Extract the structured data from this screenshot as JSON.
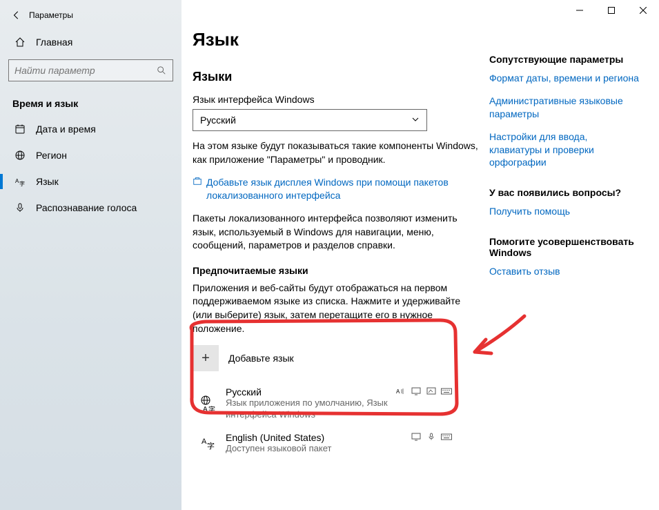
{
  "window": {
    "title": "Параметры"
  },
  "sidebar": {
    "home": "Главная",
    "search_placeholder": "Найти параметр",
    "group": "Время и язык",
    "items": [
      {
        "icon": "clock-icon",
        "label": "Дата и время"
      },
      {
        "icon": "globe-icon",
        "label": "Регион"
      },
      {
        "icon": "lang-icon",
        "label": "Язык",
        "active": true
      },
      {
        "icon": "mic-icon",
        "label": "Распознавание голоса"
      }
    ]
  },
  "main": {
    "h1": "Язык",
    "h2": "Языки",
    "display_label": "Язык интерфейса Windows",
    "display_value": "Русский",
    "display_desc": "На этом языке будут показываться такие компоненты Windows, как приложение \"Параметры\" и проводник.",
    "store_link": "Добавьте язык дисплея Windows при помощи пакетов локализованного интерфейса",
    "store_desc": "Пакеты локализованного интерфейса позволяют изменить язык, используемый в Windows для навигации, меню, сообщений, параметров и разделов справки.",
    "preferred_h": "Предпочитаемые языки",
    "preferred_desc": "Приложения и веб-сайты будут отображаться на первом поддерживаемом языке из списка. Нажмите и удерживайте (или выберите) язык, затем перетащите его в нужное положение.",
    "add_label": "Добавьте язык",
    "languages": [
      {
        "name": "Русский",
        "sub": "Язык приложения по умолчанию, Язык интерфейса Windows",
        "features": [
          "tts",
          "display",
          "ink",
          "keyboard"
        ]
      },
      {
        "name": "English (United States)",
        "sub": "Доступен языковой пакет",
        "features": [
          "display",
          "mic",
          "keyboard"
        ]
      }
    ]
  },
  "aside": {
    "related_h": "Сопутствующие параметры",
    "related_links": [
      "Формат даты, времени и региона",
      "Административные языковые параметры",
      "Настройки для ввода, клавиатуры и проверки орфографии"
    ],
    "help_h": "У вас появились вопросы?",
    "help_link": "Получить помощь",
    "feedback_h": "Помогите усовершенствовать Windows",
    "feedback_link": "Оставить отзыв"
  }
}
